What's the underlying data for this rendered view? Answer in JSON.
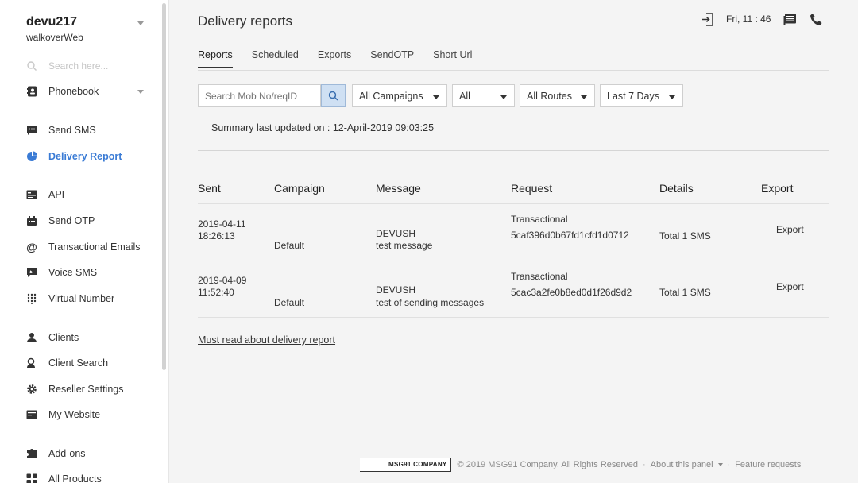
{
  "account": {
    "name": "devu217",
    "company": "walkoverWeb"
  },
  "sidebar": {
    "search_placeholder": "Search here...",
    "items": [
      {
        "label": "Phonebook",
        "icon": "phonebook-icon"
      },
      {
        "label": "Send SMS",
        "icon": "message-icon"
      },
      {
        "label": "Delivery Report",
        "icon": "pie-chart-icon",
        "active": true
      },
      {
        "label": "API",
        "icon": "api-icon"
      },
      {
        "label": "Send OTP",
        "icon": "otp-icon"
      },
      {
        "label": "Transactional Emails",
        "icon": "at-icon"
      },
      {
        "label": "Voice SMS",
        "icon": "voice-icon"
      },
      {
        "label": "Virtual Number",
        "icon": "dialpad-icon"
      },
      {
        "label": "Clients",
        "icon": "clients-icon"
      },
      {
        "label": "Client Search",
        "icon": "client-search-icon"
      },
      {
        "label": "Reseller Settings",
        "icon": "gear-icon"
      },
      {
        "label": "My Website",
        "icon": "website-icon"
      },
      {
        "label": "Add-ons",
        "icon": "addons-icon"
      },
      {
        "label": "All Products",
        "icon": "grid-icon"
      }
    ]
  },
  "header": {
    "title": "Delivery reports",
    "clock": "Fri, 11 : 46"
  },
  "tabs": [
    {
      "label": "Reports",
      "active": true
    },
    {
      "label": "Scheduled"
    },
    {
      "label": "Exports"
    },
    {
      "label": "SendOTP"
    },
    {
      "label": "Short Url"
    }
  ],
  "filters": {
    "search_placeholder": "Search Mob No/reqID",
    "campaigns": "All Campaigns",
    "status": "All",
    "routes": "All Routes",
    "range": "Last 7 Days"
  },
  "summary": "Summary last updated on : 12-April-2019 09:03:25",
  "table": {
    "headers": [
      "Sent",
      "Campaign",
      "Message",
      "Request",
      "Details",
      "Export"
    ],
    "rows": [
      {
        "date": "2019-04-11",
        "time": "18:26:13",
        "campaign": "Default",
        "sender": "DEVUSH",
        "message": "test message",
        "route": "Transactional",
        "request_id": "5caf396d0b67fd1cfd1d0712",
        "details": "Total 1 SMS",
        "export": "Export"
      },
      {
        "date": "2019-04-09",
        "time": "11:52:40",
        "campaign": "Default",
        "sender": "DEVUSH",
        "message": "test of sending messages",
        "route": "Transactional",
        "request_id": "5cac3a2fe0b8ed0d1f26d9d2",
        "details": "Total 1 SMS",
        "export": "Export"
      }
    ]
  },
  "must_read": "Must read about delivery report",
  "footer": {
    "logo": "MSG91 COMPANY",
    "copyright": "© 2019 MSG91 Company. All Rights Reserved",
    "about": "About this panel",
    "feature": "Feature requests"
  },
  "colors": {
    "accent": "#3a7bd5",
    "background": "#f4f4f4"
  }
}
